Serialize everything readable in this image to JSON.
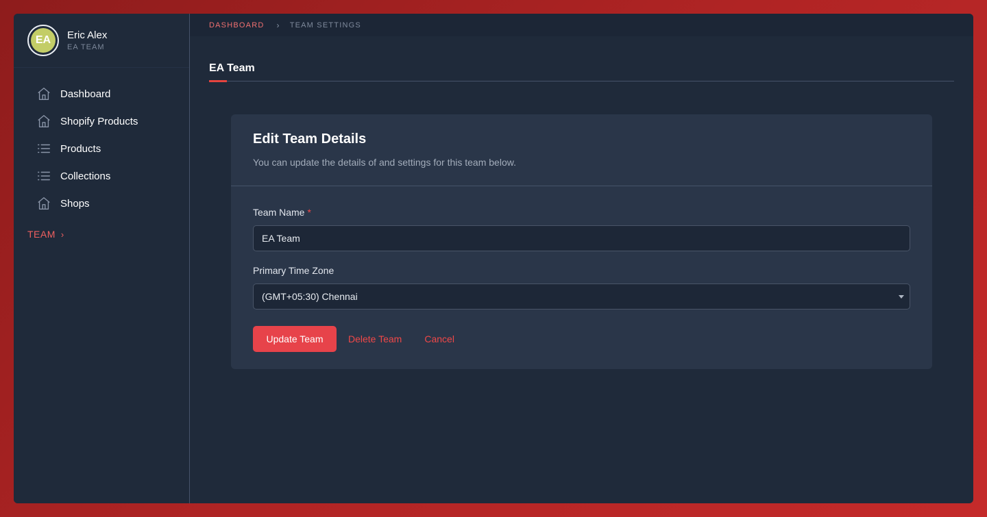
{
  "profile": {
    "initials": "EA",
    "name": "Eric Alex",
    "team": "EA TEAM"
  },
  "sidebar": {
    "items": [
      {
        "label": "Dashboard",
        "icon": "home-icon"
      },
      {
        "label": "Shopify Products",
        "icon": "home-icon"
      },
      {
        "label": "Products",
        "icon": "list-icon"
      },
      {
        "label": "Collections",
        "icon": "list-icon"
      },
      {
        "label": "Shops",
        "icon": "home-icon"
      }
    ],
    "team_section": {
      "label": "TEAM",
      "chevron": "›"
    }
  },
  "breadcrumb": {
    "root": "DASHBOARD",
    "separator": "›",
    "current": "TEAM SETTINGS"
  },
  "page": {
    "title": "EA Team"
  },
  "form": {
    "title": "Edit Team Details",
    "subtitle": "You can update the details of and settings for this team below.",
    "team_name_label": "Team Name",
    "required_mark": "*",
    "team_name_value": "EA Team",
    "timezone_label": "Primary Time Zone",
    "timezone_value": "(GMT+05:30) Chennai",
    "update_label": "Update Team",
    "delete_label": "Delete Team",
    "cancel_label": "Cancel"
  },
  "colors": {
    "accent": "#e7434a",
    "background": "#1f2a3a",
    "card": "#2a3649",
    "avatar": "#c3cd67"
  }
}
